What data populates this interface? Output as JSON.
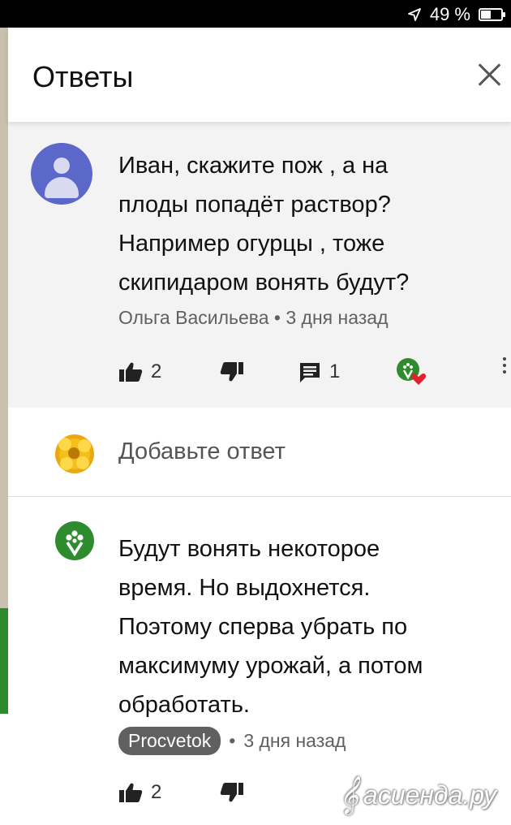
{
  "status_bar": {
    "battery": "49 %",
    "battery_level": 0.49
  },
  "header": {
    "title": "Ответы"
  },
  "parent_comment": {
    "lines": [
      "Иван, скажите пож , а на",
      "плоды попадёт раствор?",
      "Например огурцы , тоже",
      "скипидаром вонять будут?"
    ],
    "author": "Ольга Васильева",
    "time": "3 дня назад",
    "likes": "2",
    "replies": "1"
  },
  "add_reply": {
    "prompt": "Добавьте ответ"
  },
  "reply": {
    "lines": [
      "Будут вонять некоторое",
      "время. Но выдохнется.",
      "Поэтому сперва убрать по",
      "максимуму урожай, а потом",
      "обработать."
    ],
    "author": "Procvetok",
    "time": "3 дня назад",
    "likes": "2"
  },
  "watermark": {
    "text": "асиенда.ру"
  },
  "colors": {
    "avatar": "#5b67c9",
    "brand_green": "#2e8b2e",
    "heart": "#e0202a"
  },
  "icons": [
    "location-arrow-icon",
    "battery-icon",
    "close-icon",
    "thumbs-up-icon",
    "thumbs-down-icon",
    "comment-icon",
    "creator-heart-icon",
    "more-icon"
  ]
}
